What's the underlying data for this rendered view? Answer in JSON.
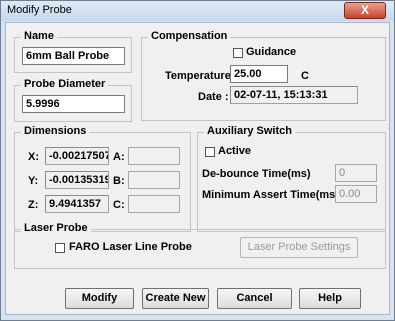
{
  "window": {
    "title": "Modify Probe",
    "close_glyph": "X"
  },
  "name": {
    "label": "Name",
    "value": "6mm Ball Probe"
  },
  "probe_diameter": {
    "label": "Probe Diameter",
    "value": "5.9996"
  },
  "compensation": {
    "label": "Compensation",
    "guidance_label": "Guidance",
    "guidance_checked": false,
    "temperature_label": "Temperature :",
    "temperature_value": "25.00",
    "temperature_unit": "C",
    "date_label": "Date :",
    "date_value": "02-07-11,  15:13:31"
  },
  "dimensions": {
    "label": "Dimensions",
    "x_label": "X:",
    "x_value": "-0.00217507",
    "y_label": "Y:",
    "y_value": "-0.00135319",
    "z_label": "Z:",
    "z_value": "9.4941357",
    "a_label": "A:",
    "a_value": "",
    "b_label": "B:",
    "b_value": "",
    "c_label": "C:",
    "c_value": ""
  },
  "auxiliary_switch": {
    "label": "Auxiliary Switch",
    "active_label": "Active",
    "active_checked": false,
    "debounce_label": "De-bounce Time(ms)",
    "debounce_value": "0",
    "min_assert_label": "Minimum Assert Time(ms)",
    "min_assert_value": "0.00"
  },
  "laser_probe": {
    "label": "Laser Probe",
    "faro_label": "FARO Laser Line Probe",
    "faro_checked": false,
    "settings_button": "Laser Probe Settings"
  },
  "buttons": {
    "modify": "Modify",
    "create_new": "Create New",
    "cancel": "Cancel",
    "help": "Help"
  }
}
